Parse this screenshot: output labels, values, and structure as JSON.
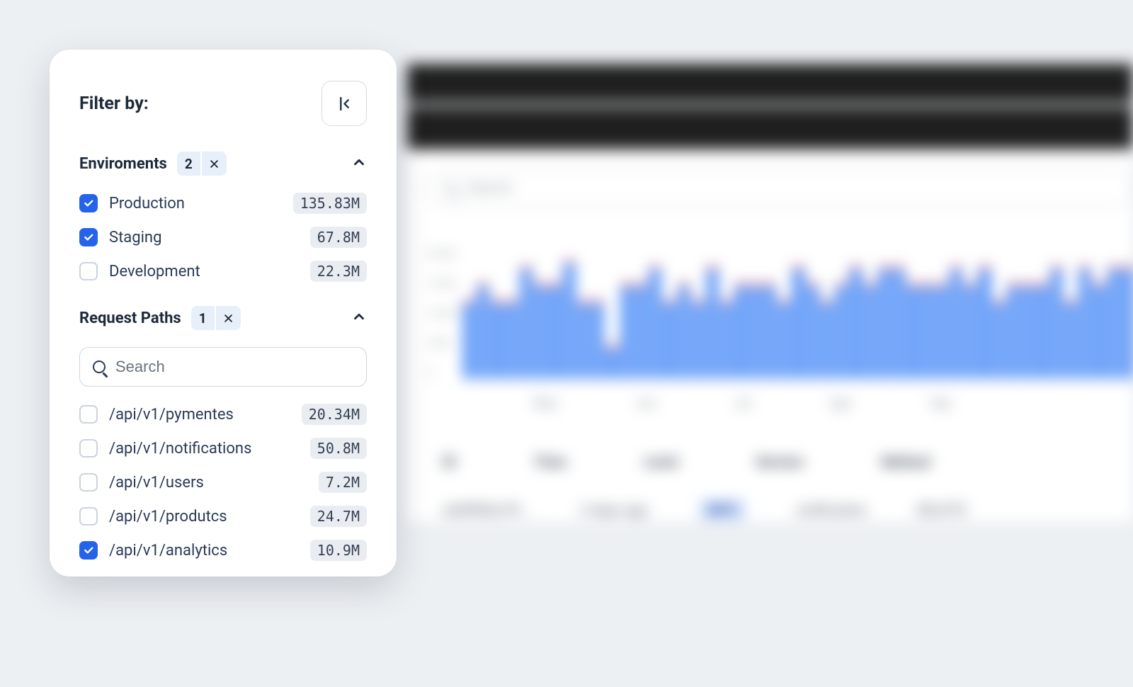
{
  "filter": {
    "title": "Filter by:",
    "environments": {
      "title": "Enviroments",
      "count": "2",
      "items": [
        {
          "label": "Production",
          "value": "135.83M",
          "checked": true
        },
        {
          "label": "Staging",
          "value": "67.8M",
          "checked": true
        },
        {
          "label": "Development",
          "value": "22.3M",
          "checked": false
        }
      ]
    },
    "request_paths": {
      "title": "Request Paths",
      "count": "1",
      "search_placeholder": "Search",
      "items": [
        {
          "label": "/api/v1/pymentes",
          "value": "20.34M",
          "checked": false
        },
        {
          "label": "/api/v1/notifications",
          "value": "50.8M",
          "checked": false
        },
        {
          "label": "/api/v1/users",
          "value": "7.2M",
          "checked": false
        },
        {
          "label": "/api/v1/produtcs",
          "value": "24.7M",
          "checked": false
        },
        {
          "label": "/api/v1/analytics",
          "value": "10.9M",
          "checked": true
        }
      ]
    }
  },
  "background": {
    "search_placeholder": "Search",
    "chart_months": [
      "May",
      "Jun",
      "Jul",
      "Ago",
      "Sep"
    ],
    "table_headers": [
      "ID",
      "Time",
      "Level",
      "Service",
      "Method"
    ],
    "row": {
      "id": "a3df982e-f9...",
      "time": "2 days ago",
      "level": "INFO",
      "service": "notification",
      "method": "DELETE"
    }
  },
  "chart_data": {
    "type": "bar",
    "title": "",
    "xlabel": "",
    "ylabel": "",
    "ylim": [
      0,
      22
    ],
    "yticks": [
      "20.0M",
      "15.0M",
      "10.0M",
      "5.0M",
      "0"
    ],
    "yticks_numeric": [
      20,
      15,
      10,
      5,
      0
    ],
    "months": [
      "May",
      "Jun",
      "Jul",
      "Ago",
      "Sep"
    ],
    "series": [
      {
        "name": "requests",
        "color": "#3b82f6",
        "values": [
          14,
          17,
          14,
          14,
          20,
          17,
          17,
          21,
          14,
          14,
          6,
          17,
          17,
          20,
          14,
          17,
          14,
          20,
          14,
          17,
          17,
          17,
          14,
          20,
          17,
          14,
          17,
          20,
          17,
          20,
          20,
          17,
          17,
          17,
          20,
          17,
          20,
          14,
          17,
          17,
          17,
          20,
          14,
          20,
          17,
          20,
          20
        ]
      },
      {
        "name": "errors_cap",
        "color": "#f36b6b",
        "values": [
          1,
          1,
          1,
          1,
          1,
          1,
          1,
          1,
          1,
          1,
          1,
          1,
          1,
          1,
          1,
          1,
          1,
          1,
          1,
          1,
          1,
          1,
          1,
          1,
          1,
          1,
          1,
          1,
          1,
          1,
          1,
          1,
          1,
          1,
          1,
          1,
          1,
          1,
          1,
          1,
          1,
          1,
          1,
          1,
          1,
          1,
          1
        ]
      }
    ]
  }
}
